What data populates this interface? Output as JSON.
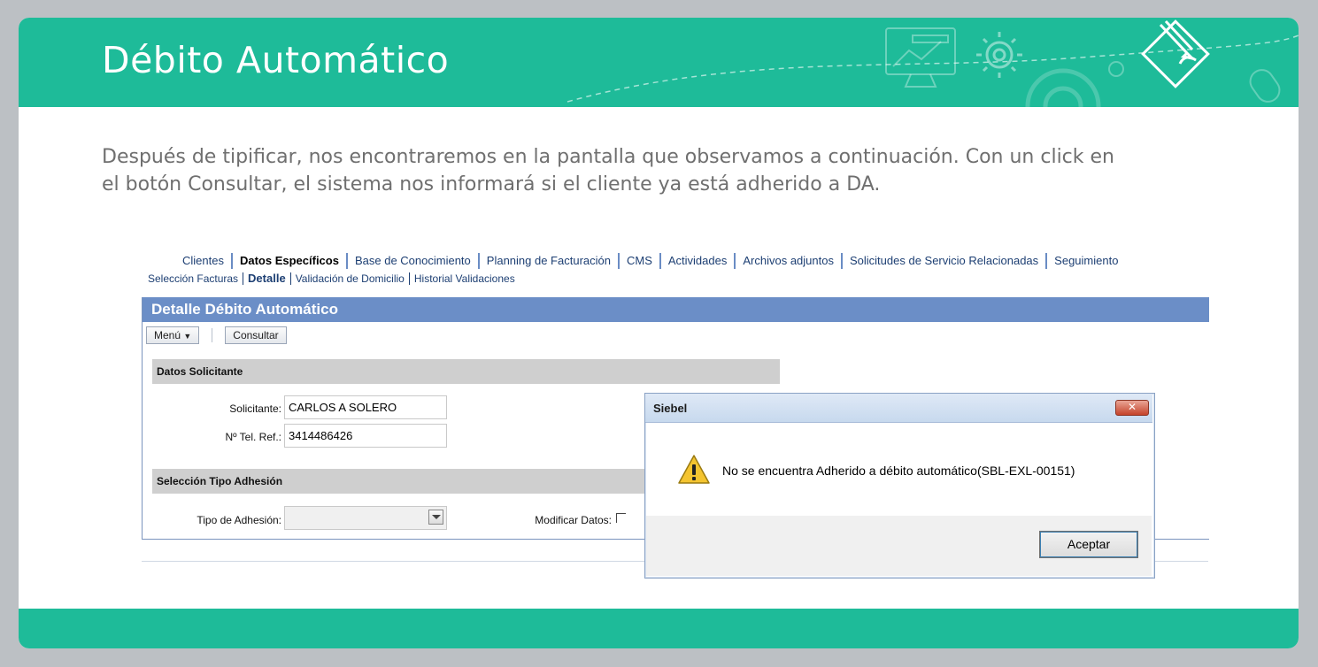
{
  "slide": {
    "title": "Débito Automático",
    "intro": "Después de tipificar, nos encontraremos en la pantalla que observamos a continuación. Con un click en el botón Consultar, el sistema nos informará si el cliente ya está adherido a DA.",
    "accent_color": "#1ebb99"
  },
  "siebel": {
    "tabs": [
      {
        "label": "Clientes"
      },
      {
        "label": "Datos Específicos",
        "active": true
      },
      {
        "label": "Base de Conocimiento"
      },
      {
        "label": "Planning de Facturación"
      },
      {
        "label": "CMS"
      },
      {
        "label": "Actividades"
      },
      {
        "label": "Archivos adjuntos"
      },
      {
        "label": "Solicitudes de Servicio Relacionadas"
      },
      {
        "label": "Seguimiento"
      }
    ],
    "subtabs": [
      {
        "label": "Selección Facturas"
      },
      {
        "label": "Detalle",
        "active": true
      },
      {
        "label": "Validación de Domicilio"
      },
      {
        "label": "Historial Validaciones"
      }
    ],
    "applet_title": "Detalle Débito Automático",
    "menu_label": "Menú",
    "consultar_label": "Consultar",
    "section_datos": "Datos Solicitante",
    "solicitante_label": "Solicitante:",
    "solicitante_value": "CARLOS A SOLERO",
    "tel_label": "Nº Tel. Ref.:",
    "tel_value": "3414486426",
    "section_tipo": "Selección Tipo Adhesión",
    "tipo_label": "Tipo de Adhesión:",
    "tipo_value": "",
    "modificar_label": "Modificar Datos:",
    "modificar_checked": false
  },
  "dialog": {
    "title": "Siebel",
    "message": "No se encuentra Adherido a débito automático(SBL-EXL-00151)",
    "ok_label": "Aceptar",
    "icon": "warning-icon"
  }
}
